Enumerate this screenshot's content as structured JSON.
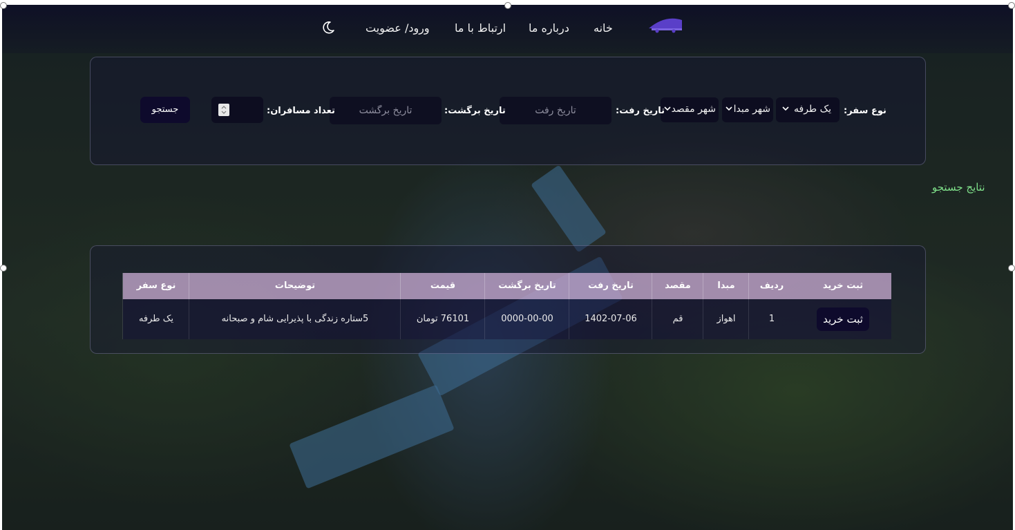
{
  "nav": {
    "home": "خانه",
    "about": "درباره ما",
    "contact": "ارتباط با ما",
    "login": "ورود/ عضویت"
  },
  "search": {
    "trip_type_label": "نوع سفر:",
    "trip_type_value": "یک طرفه",
    "origin_value": "شهر مبدا",
    "destination_value": "شهر مقصد",
    "depart_label": "تاریخ رفت:",
    "depart_placeholder": "تاریخ رفت",
    "return_label": "تاریخ برگشت:",
    "return_placeholder": "تاریخ برگشت",
    "passengers_label": "تعداد مسافران:",
    "search_button": "جستجو"
  },
  "results": {
    "title": "نتایج جستجو",
    "columns": {
      "buy": "ثبت خرید",
      "row": "ردیف",
      "origin": "مبدا",
      "destination": "مقصد",
      "depart_date": "تاریخ رفت",
      "return_date": "تاریخ برگشت",
      "price": "قیمت",
      "description": "توضیحات",
      "trip_type": "نوع سفر"
    },
    "rows": [
      {
        "buy_button": "ثبت خرید",
        "row": "1",
        "origin": "اهواز",
        "destination": "قم",
        "depart_date": "1402-07-06",
        "return_date": "0000-00-00",
        "price": "76101 تومان",
        "description": "5ستاره زندگی با پذیرایی شام و صبحانه",
        "trip_type": "یک طرفه"
      }
    ]
  },
  "colors": {
    "accent_dark": "#0e0a2c",
    "results_title": "#7fe08a",
    "table_header": "#cdafd7"
  },
  "icons": {
    "theme_toggle": "moon-icon",
    "logo": "train-ticket-logo"
  }
}
